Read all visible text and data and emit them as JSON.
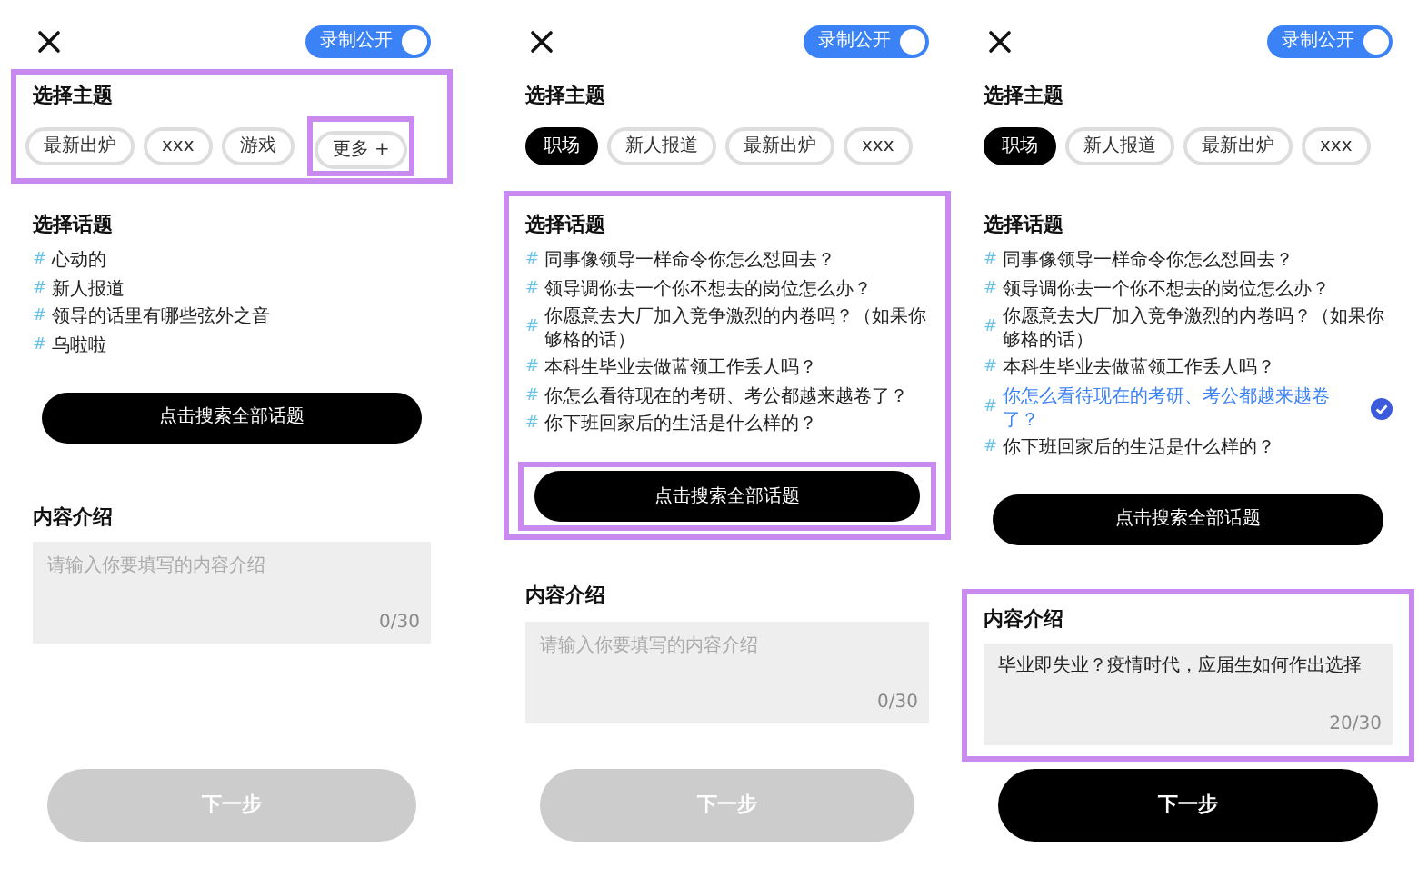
{
  "screens": [
    {
      "privacy_toggle": {
        "label": "录制公开",
        "on": true
      },
      "theme_section": {
        "title": "选择主题",
        "highlighted": true,
        "chips": [
          {
            "label": "最新出炉",
            "selected": false,
            "highlighted": false
          },
          {
            "label": "xxx",
            "selected": false,
            "highlighted": false
          },
          {
            "label": "游戏",
            "selected": false,
            "highlighted": false
          },
          {
            "label": "更多 +",
            "selected": false,
            "highlighted": true
          }
        ]
      },
      "topic_section": {
        "title": "选择话题",
        "highlighted": false,
        "topics": [
          {
            "hash": "#",
            "text": "心动的",
            "selected": false
          },
          {
            "hash": "#",
            "text": "新人报道",
            "selected": false
          },
          {
            "hash": "#",
            "text": "领导的话里有哪些弦外之音",
            "selected": false
          },
          {
            "hash": "#",
            "text": "乌啦啦",
            "selected": false
          }
        ]
      },
      "search_button": {
        "label": "点击搜索全部话题",
        "highlighted": false
      },
      "intro_section": {
        "title": "内容介绍",
        "highlighted": false,
        "placeholder": "请输入你要填写的内容介绍",
        "counter": "0/30"
      },
      "next_button": {
        "label": "下一步",
        "disabled": true
      }
    },
    {
      "privacy_toggle": {
        "label": "录制公开",
        "on": true
      },
      "theme_section": {
        "title": "选择主题",
        "highlighted": false,
        "chips": [
          {
            "label": "职场",
            "selected": true,
            "highlighted": false
          },
          {
            "label": "新人报道",
            "selected": false,
            "highlighted": false
          },
          {
            "label": "最新出炉",
            "selected": false,
            "highlighted": false
          },
          {
            "label": "xxx",
            "selected": false,
            "highlighted": false
          }
        ]
      },
      "topic_section": {
        "title": "选择话题",
        "highlighted": true,
        "topics": [
          {
            "hash": "#",
            "text": "同事像领导一样命令你怎么怼回去？",
            "selected": false
          },
          {
            "hash": "#",
            "text": "领导调你去一个你不想去的岗位怎么办？",
            "selected": false
          },
          {
            "hash": "#",
            "text": "你愿意去大厂加入竞争激烈的内卷吗？（如果你够格的话）",
            "selected": false
          },
          {
            "hash": "#",
            "text": "本科生毕业去做蓝领工作丢人吗？",
            "selected": false
          },
          {
            "hash": "#",
            "text": "你怎么看待现在的考研、考公都越来越卷了？",
            "selected": false
          },
          {
            "hash": "#",
            "text": "你下班回家后的生活是什么样的？",
            "selected": false
          }
        ]
      },
      "search_button": {
        "label": "点击搜索全部话题",
        "highlighted": true
      },
      "intro_section": {
        "title": "内容介绍",
        "highlighted": false,
        "placeholder": "请输入你要填写的内容介绍",
        "counter": "0/30"
      },
      "next_button": {
        "label": "下一步",
        "disabled": true
      }
    },
    {
      "privacy_toggle": {
        "label": "录制公开",
        "on": true
      },
      "theme_section": {
        "title": "选择主题",
        "highlighted": false,
        "chips": [
          {
            "label": "职场",
            "selected": true,
            "highlighted": false
          },
          {
            "label": "新人报道",
            "selected": false,
            "highlighted": false
          },
          {
            "label": "最新出炉",
            "selected": false,
            "highlighted": false
          },
          {
            "label": "xxx",
            "selected": false,
            "highlighted": false
          }
        ]
      },
      "topic_section": {
        "title": "选择话题",
        "highlighted": false,
        "topics": [
          {
            "hash": "#",
            "text": "同事像领导一样命令你怎么怼回去？",
            "selected": false
          },
          {
            "hash": "#",
            "text": "领导调你去一个你不想去的岗位怎么办？",
            "selected": false
          },
          {
            "hash": "#",
            "text": "你愿意去大厂加入竞争激烈的内卷吗？（如果你够格的话）",
            "selected": false
          },
          {
            "hash": "#",
            "text": "本科生毕业去做蓝领工作丢人吗？",
            "selected": false
          },
          {
            "hash": "#",
            "text": "你怎么看待现在的考研、考公都越来越卷了？",
            "selected": true
          },
          {
            "hash": "#",
            "text": "你下班回家后的生活是什么样的？",
            "selected": false
          }
        ]
      },
      "search_button": {
        "label": "点击搜索全部话题",
        "highlighted": false
      },
      "intro_section": {
        "title": "内容介绍",
        "highlighted": true,
        "value": "毕业即失业？疫情时代，应届生如何作出选择",
        "counter": "20/30"
      },
      "next_button": {
        "label": "下一步",
        "disabled": false
      }
    }
  ]
}
